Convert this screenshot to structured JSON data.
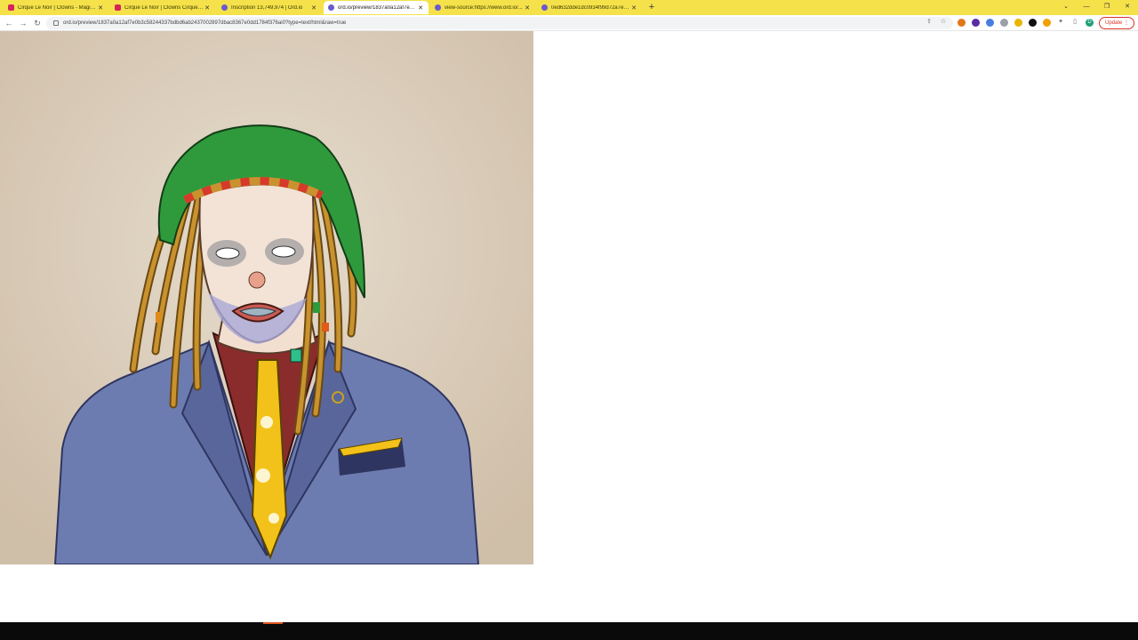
{
  "browser": {
    "tabs": [
      {
        "title": "Cirque Le Noir | Clowns - Magic ...",
        "favicon": "magic-eden-icon",
        "active": false
      },
      {
        "title": "Cirque Le Noir | Clowns Cirque L...",
        "favicon": "magic-eden-icon",
        "active": false
      },
      {
        "title": "Inscription 13,749,974 | Ord.io",
        "favicon": "ord-io-icon",
        "active": false
      },
      {
        "title": "ord.io/preview/1837a0a12af7e0...",
        "favicon": "ord-io-icon",
        "active": true
      },
      {
        "title": "view-source:https://www.ord.io/...",
        "favicon": "ord-io-icon",
        "active": false
      },
      {
        "title": "0ed632dde1dc0934f99d72a7e2...",
        "favicon": "ord-io-icon",
        "active": false
      }
    ],
    "url": "ord.io/preview/1837a0a12af7e0b3c58244337bdbd6ab2437002897dbac8367e0dd1784f376ai0?type=text/html&raw=true",
    "update_label": "Update",
    "profile_initial": "D"
  },
  "artwork": {
    "description_icon": "clown-portrait-image"
  },
  "colors": {
    "tab_strip": "#f5e14a",
    "background": "#ffffff",
    "art_background": "#ddd0c0",
    "suit": "#6d7cb0",
    "hat": "#2f9a3c",
    "tie": "#f2c21a",
    "shirt": "#8a2c2c"
  }
}
